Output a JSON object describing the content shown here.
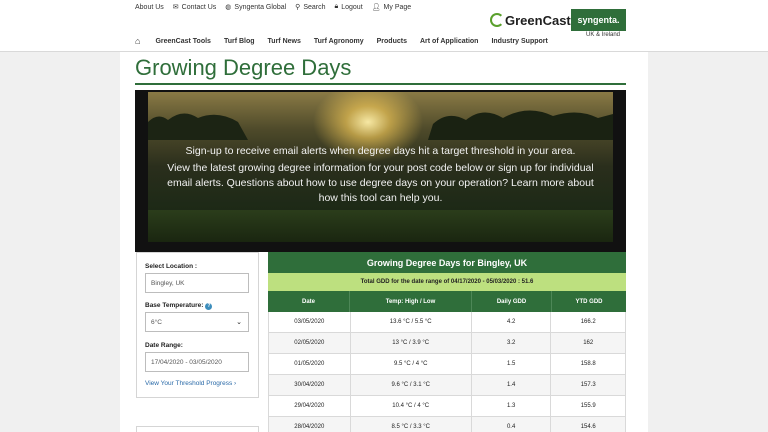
{
  "utility_nav": [
    {
      "label": "About Us",
      "icon": ""
    },
    {
      "label": "Contact Us",
      "icon": "mail-icon"
    },
    {
      "label": "Syngenta Global",
      "icon": "globe-icon"
    },
    {
      "label": "Search",
      "icon": "search-icon"
    },
    {
      "label": "Logout",
      "icon": "lock-icon"
    },
    {
      "label": "My Page",
      "icon": "user-icon"
    }
  ],
  "logo": {
    "greencast": "GreenCast",
    "syngenta": "syngenta.",
    "region": "UK & Ireland"
  },
  "main_nav": [
    "GreenCast Tools",
    "Turf Blog",
    "Turf News",
    "Turf Agronomy",
    "Products",
    "Art of Application",
    "Industry Support"
  ],
  "page_title": "Growing Degree Days",
  "hero": {
    "line1": "Sign-up to receive email alerts when degree days hit a target threshold in your area.",
    "line2": "View the latest growing degree information for your post code below or sign up for individual email alerts. Questions about how to use degree days on your operation? Learn more about how this tool can help you."
  },
  "form": {
    "location_label": "Select Location :",
    "location_value": "Bingley, UK",
    "base_temp_label": "Base Temperature:",
    "base_temp_value": "6°C",
    "date_range_label": "Date Range:",
    "date_range_value": "17/04/2020 - 03/05/2020",
    "threshold_link": "View Your Threshold Progress ›"
  },
  "table": {
    "title": "Growing Degree Days for Bingley, UK",
    "range_text": "Total GDD for the date range of 04/17/2020 - 05/03/2020 : 51.6",
    "headers": [
      "Date",
      "Temp: High / Low",
      "Daily GDD",
      "YTD GDD"
    ],
    "rows": [
      [
        "03/05/2020",
        "13.6 °C / 5.5 °C",
        "4.2",
        "166.2"
      ],
      [
        "02/05/2020",
        "13 °C / 3.9 °C",
        "3.2",
        "162"
      ],
      [
        "01/05/2020",
        "9.5 °C / 4 °C",
        "1.5",
        "158.8"
      ],
      [
        "30/04/2020",
        "9.6 °C / 3.1 °C",
        "1.4",
        "157.3"
      ],
      [
        "29/04/2020",
        "10.4 °C / 4 °C",
        "1.3",
        "155.9"
      ],
      [
        "28/04/2020",
        "8.5 °C / 3.3 °C",
        "0.4",
        "154.6"
      ]
    ]
  },
  "colors": {
    "brand_green": "#2f6e3a",
    "range_green": "#bde07f",
    "link_blue": "#2a6aa8"
  }
}
